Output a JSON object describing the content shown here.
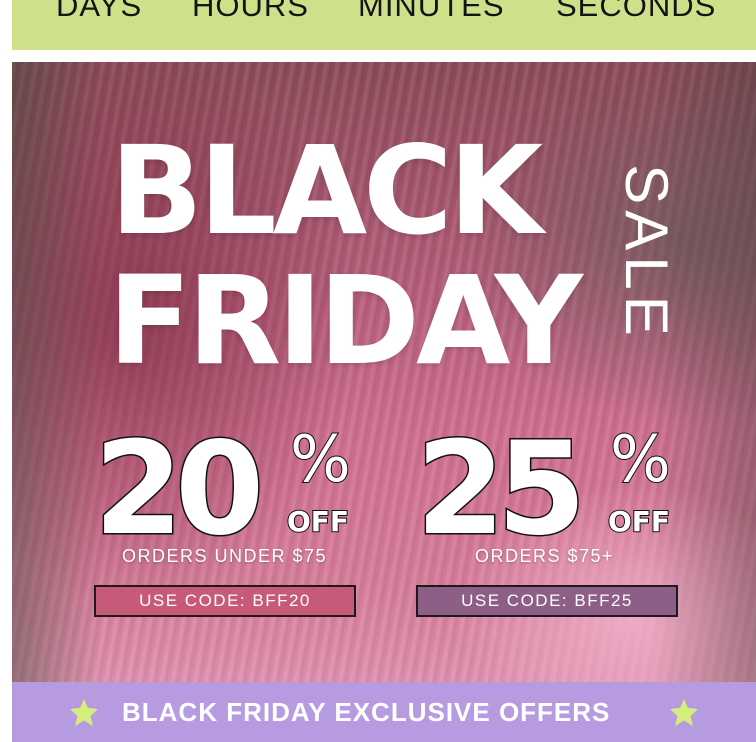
{
  "countdown": {
    "labels": [
      "DAYS",
      "HOURS",
      "MINUTES",
      "SECONDS"
    ],
    "background_color": "#cfe08a"
  },
  "hero": {
    "headline_line1": "BLACK",
    "headline_line2": "FRIDAY",
    "headline_side": "SALE",
    "offers": [
      {
        "percent": "20",
        "percent_sign": "%",
        "off": "OFF",
        "condition": "ORDERS UNDER $75",
        "code_text": "USE CODE: BFF20",
        "code_color": "#c75a79"
      },
      {
        "percent": "25",
        "percent_sign": "%",
        "off": "OFF",
        "condition": "ORDERS $75+",
        "code_text": "USE CODE: BFF25",
        "code_color": "#8e5f86"
      }
    ]
  },
  "banner": {
    "text": "BLACK FRIDAY EXCLUSIVE OFFERS",
    "background_color": "#b79be0",
    "icon": "star-icon",
    "icon_color": "#d3ee7a"
  }
}
